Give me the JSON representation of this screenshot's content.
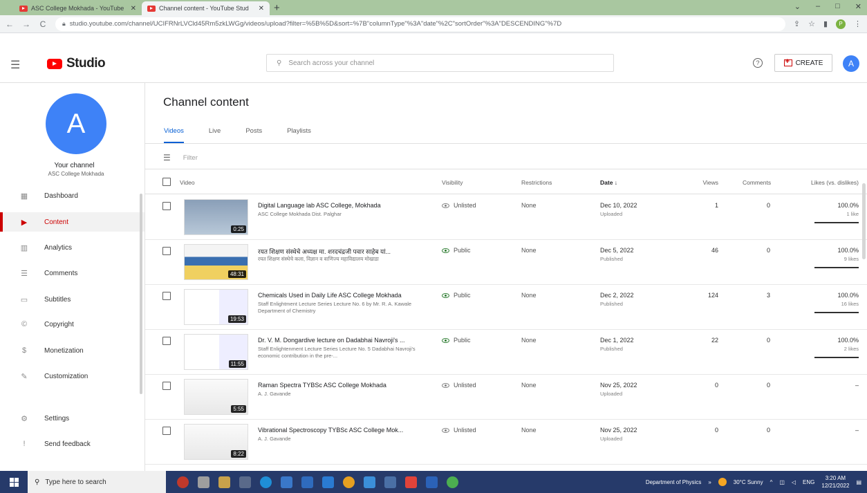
{
  "browser": {
    "tabs": [
      {
        "title": "ASC College Mokhada - YouTube",
        "active": false
      },
      {
        "title": "Channel content - YouTube Stud",
        "active": true
      }
    ],
    "new_tab": "+",
    "window_controls": {
      "minimize": "–",
      "maximize": "□",
      "close": "✕",
      "dropdown": "⌄"
    },
    "url": "studio.youtube.com/channel/UCIFRNrLVCld45Rm5zkLWGg/videos/upload?filter=%5B%5D&sort=%7B\"columnType\"%3A\"date\"%2C\"sortOrder\"%3A\"DESCENDING\"%7D",
    "profile_initial": "P"
  },
  "header": {
    "logo_text": "Studio",
    "search_placeholder": "Search across your channel",
    "create_label": "CREATE",
    "avatar_initial": "A",
    "help_label": "?"
  },
  "sidebar": {
    "avatar_initial": "A",
    "your_channel": "Your channel",
    "channel_name": "ASC College Mokhada",
    "items": [
      {
        "label": "Dashboard",
        "icon": "dashboard-icon",
        "glyph": "▦",
        "active": false
      },
      {
        "label": "Content",
        "icon": "content-icon",
        "glyph": "▶",
        "active": true
      },
      {
        "label": "Analytics",
        "icon": "analytics-icon",
        "glyph": "▥",
        "active": false
      },
      {
        "label": "Comments",
        "icon": "comments-icon",
        "glyph": "☰",
        "active": false
      },
      {
        "label": "Subtitles",
        "icon": "subtitles-icon",
        "glyph": "▭",
        "active": false
      },
      {
        "label": "Copyright",
        "icon": "copyright-icon",
        "glyph": "©",
        "active": false
      },
      {
        "label": "Monetization",
        "icon": "monetization-icon",
        "glyph": "$",
        "active": false
      },
      {
        "label": "Customization",
        "icon": "customization-icon",
        "glyph": "✎",
        "active": false
      },
      {
        "label": "Settings",
        "icon": "settings-icon",
        "glyph": "⚙",
        "active": false
      },
      {
        "label": "Send feedback",
        "icon": "feedback-icon",
        "glyph": "!",
        "active": false
      }
    ]
  },
  "main": {
    "title": "Channel content",
    "tabs": [
      {
        "label": "Videos",
        "active": true
      },
      {
        "label": "Live",
        "active": false
      },
      {
        "label": "Posts",
        "active": false
      },
      {
        "label": "Playlists",
        "active": false
      }
    ],
    "filter_placeholder": "Filter",
    "columns": {
      "video": "Video",
      "visibility": "Visibility",
      "restrictions": "Restrictions",
      "date": "Date ↓",
      "views": "Views",
      "comments": "Comments",
      "likes": "Likes (vs. dislikes)"
    },
    "videos": [
      {
        "title": "Digital Language lab ASC College, Mokhada",
        "description": "ASC College Mokhada Dist. Palghar",
        "duration": "0:25",
        "visibility": "Unlisted",
        "restrictions": "None",
        "date": "Dec 10, 2022",
        "date_status": "Uploaded",
        "views": "1",
        "comments": "0",
        "likes": "100.0%",
        "likes_count": "1 like",
        "likes_fraction": 1.0,
        "thumb": "digital"
      },
      {
        "title": "रयत शिक्षण संस्थेचे अध्यक्ष मा. शरदचंद्रजी पवार साहेब यां...",
        "description": "रयत शिक्षण संस्थेचे कला, विज्ञान व वाणिज्य महाविद्यालय मोखाडा",
        "duration": "48:31",
        "visibility": "Public",
        "restrictions": "None",
        "date": "Dec 5, 2022",
        "date_status": "Published",
        "views": "46",
        "comments": "0",
        "likes": "100.0%",
        "likes_count": "9 likes",
        "likes_fraction": 1.0,
        "thumb": "event"
      },
      {
        "title": "Chemicals Used in Daily Life ASC College Mokhada",
        "description": "Staff Enlightment Lecture Series Lecture No. 6 by Mr. R. A. Kawale Department of Chemistry",
        "duration": "19:53",
        "visibility": "Public",
        "restrictions": "None",
        "date": "Dec 2, 2022",
        "date_status": "Published",
        "views": "124",
        "comments": "3",
        "likes": "100.0%",
        "likes_count": "16 likes",
        "likes_fraction": 1.0,
        "thumb": "slide"
      },
      {
        "title": "Dr. V. M. Dongardive lecture on Dadabhai Navroji's ...",
        "description": "Staff Enlightenment Lecture Series Lecture No. 5 Dadabhai Navroji's economic contribution in the pre-...",
        "duration": "11:55",
        "visibility": "Public",
        "restrictions": "None",
        "date": "Dec 1, 2022",
        "date_status": "Published",
        "views": "22",
        "comments": "0",
        "likes": "100.0%",
        "likes_count": "2 likes",
        "likes_fraction": 1.0,
        "thumb": "slide"
      },
      {
        "title": "Raman Spectra TYBSc ASC College Mokhada",
        "description": "A. J. Gavande",
        "duration": "5:55",
        "visibility": "Unlisted",
        "restrictions": "None",
        "date": "Nov 25, 2022",
        "date_status": "Uploaded",
        "views": "0",
        "comments": "0",
        "likes": "–",
        "likes_count": "",
        "likes_fraction": null,
        "thumb": "doc"
      },
      {
        "title": "Vibrational Spectroscopy TYBSc ASC College Mok...",
        "description": "A. J. Gavande",
        "duration": "8:22",
        "visibility": "Unlisted",
        "restrictions": "None",
        "date": "Nov 25, 2022",
        "date_status": "Uploaded",
        "views": "0",
        "comments": "0",
        "likes": "–",
        "likes_count": "",
        "likes_fraction": null,
        "thumb": "doc"
      }
    ]
  },
  "taskbar": {
    "search_placeholder": "Type here to search",
    "folder_label": "Department of Physics",
    "weather": "30°C Sunny",
    "language": "ENG",
    "time": "3:20 AM",
    "date": "12/21/2022"
  },
  "colors": {
    "accent_red": "#cc0000",
    "link_blue": "#065fd4",
    "avatar_blue": "#3e82f7",
    "taskbar": "#263a6a"
  }
}
